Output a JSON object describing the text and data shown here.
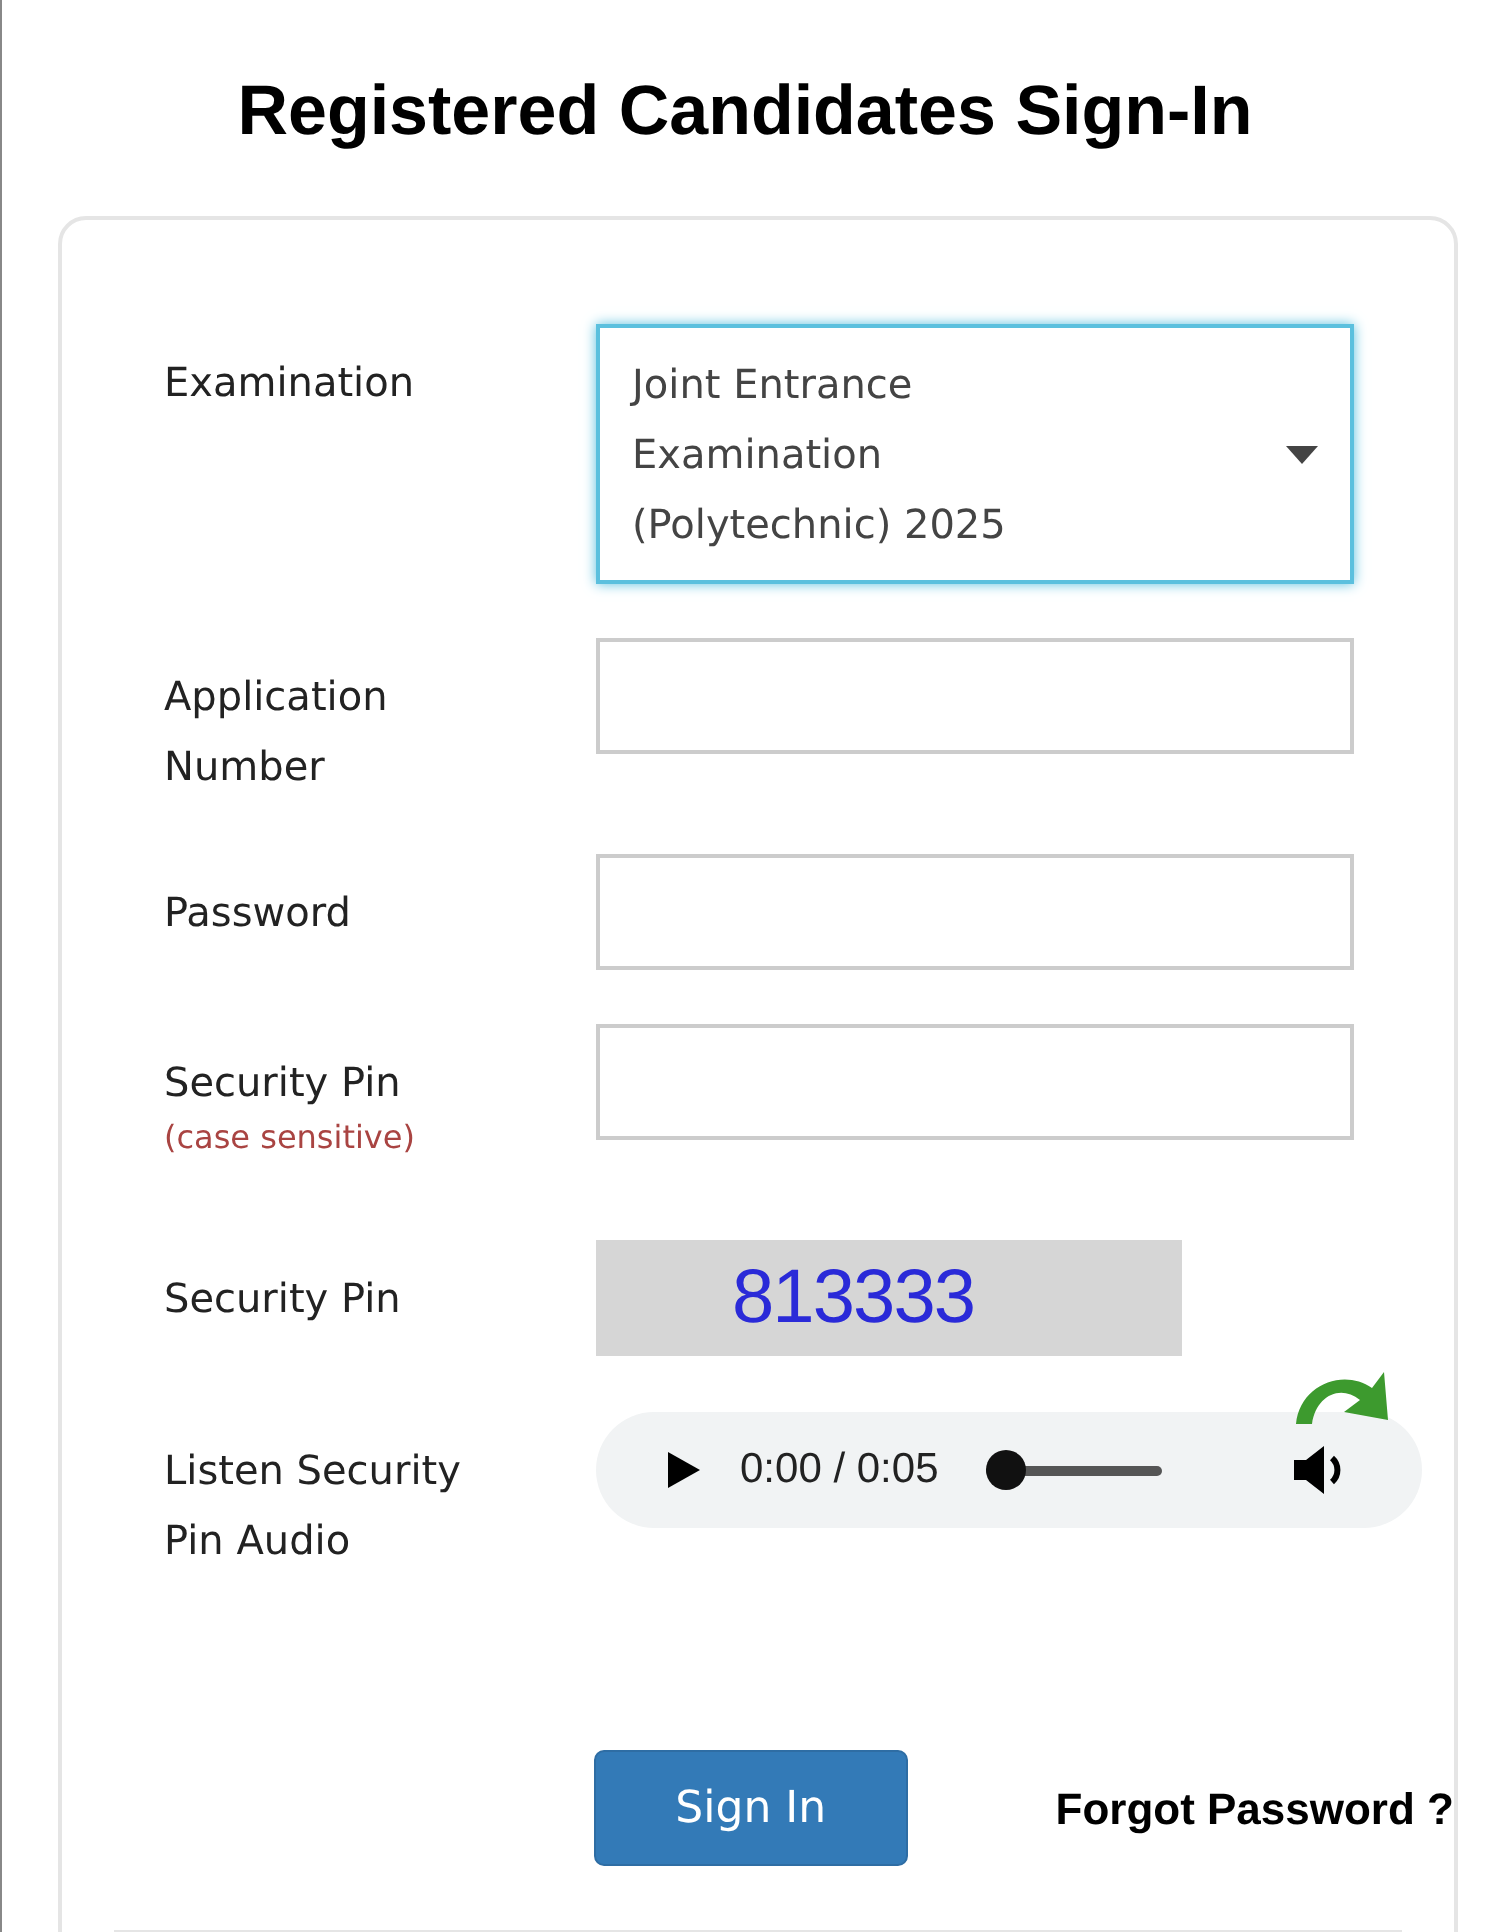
{
  "title": "Registered Candidates Sign-In",
  "fields": [
    {
      "kind": "select",
      "label": "Examination",
      "value": "Joint Entrance Examination (Polytechnic) 2025"
    },
    {
      "kind": "input",
      "label": "Application Number"
    },
    {
      "kind": "input",
      "label": "Password"
    },
    {
      "kind": "input",
      "label": "Security Pin",
      "note": "(case sensitive)"
    },
    {
      "kind": "captcha",
      "label": "Security Pin",
      "captcha_text": "813333"
    },
    {
      "kind": "audio",
      "label": "Listen Security Pin Audio",
      "time": "0:00 / 0:05",
      "level": 0
    }
  ],
  "sign_in": "Sign In",
  "forgot": "Forgot Password ?"
}
